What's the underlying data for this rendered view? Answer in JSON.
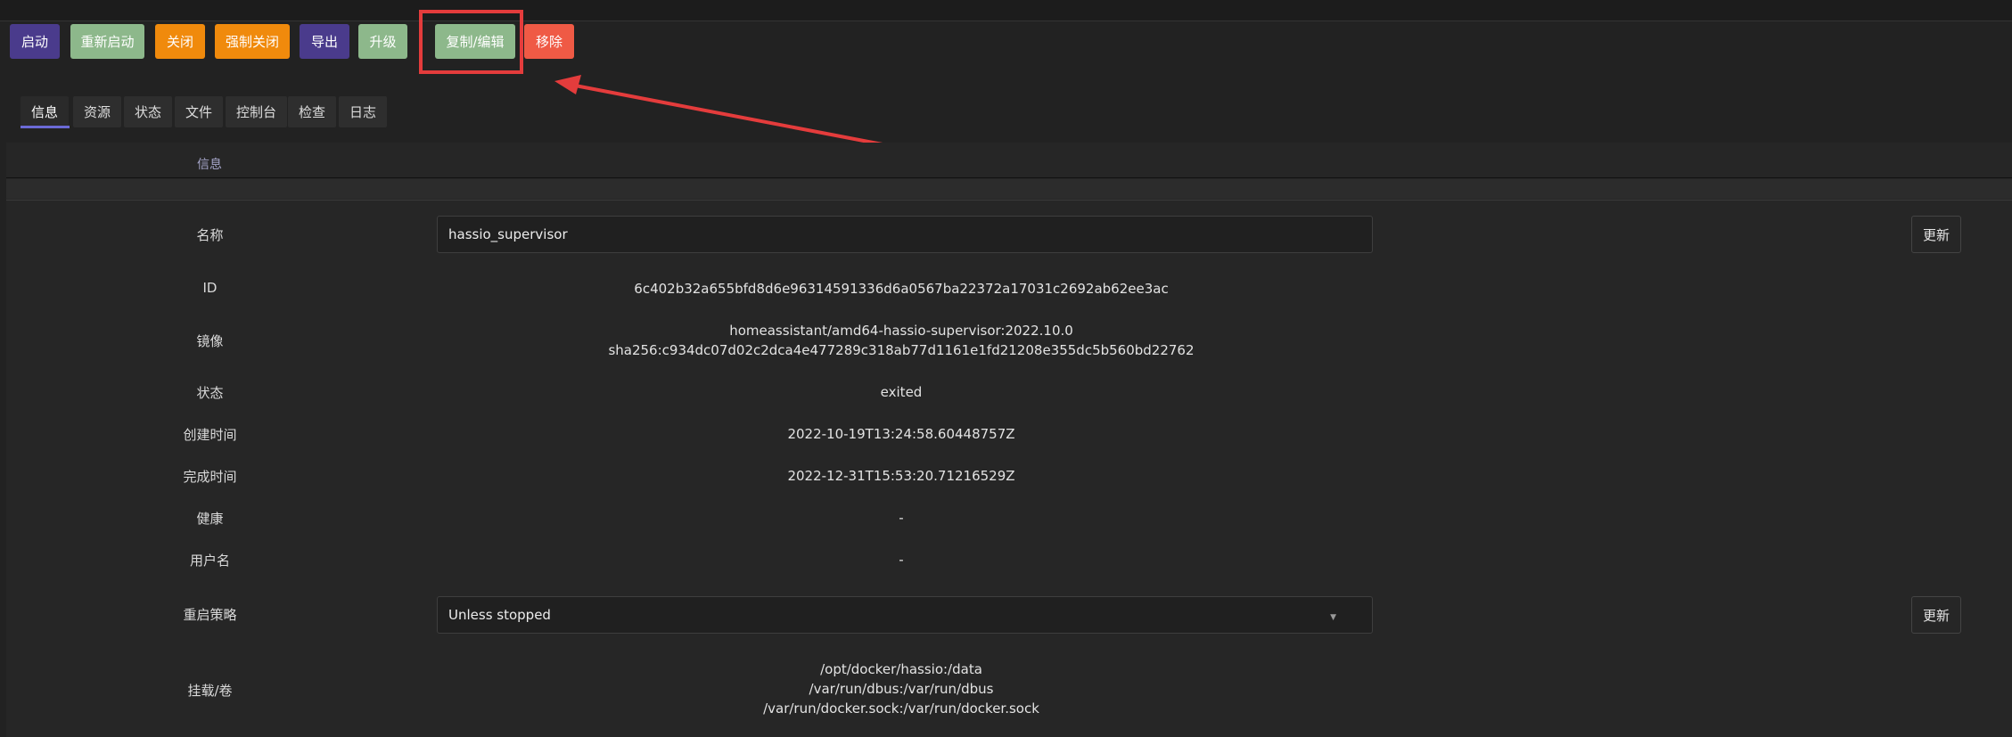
{
  "toolbar": {
    "start": "启动",
    "restart": "重新启动",
    "stop": "关闭",
    "force_stop": "强制关闭",
    "export": "导出",
    "upgrade": "升级",
    "duplicate_edit": "复制/编辑",
    "remove": "移除"
  },
  "tabs": [
    "信息",
    "资源",
    "状态",
    "文件",
    "控制台",
    "检查",
    "日志"
  ],
  "panel": {
    "header": "信息",
    "rows": {
      "name": {
        "label": "名称",
        "value": "hassio_supervisor",
        "update": "更新"
      },
      "id": {
        "label": "ID",
        "value": "6c402b32a655bfd8d6e96314591336d6a0567ba22372a17031c2692ab62ee3ac"
      },
      "image": {
        "label": "镜像",
        "line1": "homeassistant/amd64-hassio-supervisor:2022.10.0",
        "line2": "sha256:c934dc07d02c2dca4e477289c318ab77d1161e1fd21208e355dc5b560bd22762"
      },
      "status": {
        "label": "状态",
        "value": "exited"
      },
      "created": {
        "label": "创建时间",
        "value": "2022-10-19T13:24:58.60448757Z"
      },
      "finished": {
        "label": "完成时间",
        "value": "2022-12-31T15:53:20.71216529Z"
      },
      "health": {
        "label": "健康",
        "value": "-"
      },
      "username": {
        "label": "用户名",
        "value": "-"
      },
      "restart_policy": {
        "label": "重启策略",
        "value": "Unless stopped",
        "update": "更新"
      },
      "mounts": {
        "label": "挂载/卷",
        "items": [
          "/opt/docker/hassio:/data",
          "/var/run/dbus:/var/run/dbus",
          "/var/run/docker.sock:/var/run/docker.sock"
        ]
      }
    }
  },
  "icons": {
    "dropdown": "chevron-down-icon",
    "annotation": "red-arrow-icon"
  },
  "colors": {
    "purple": "#4a3b8c",
    "green": "#8db88b",
    "orange": "#f08a0c",
    "red": "#ef5a45",
    "highlight": "#e43c3c",
    "tab_indicator": "#6b6ad6"
  }
}
